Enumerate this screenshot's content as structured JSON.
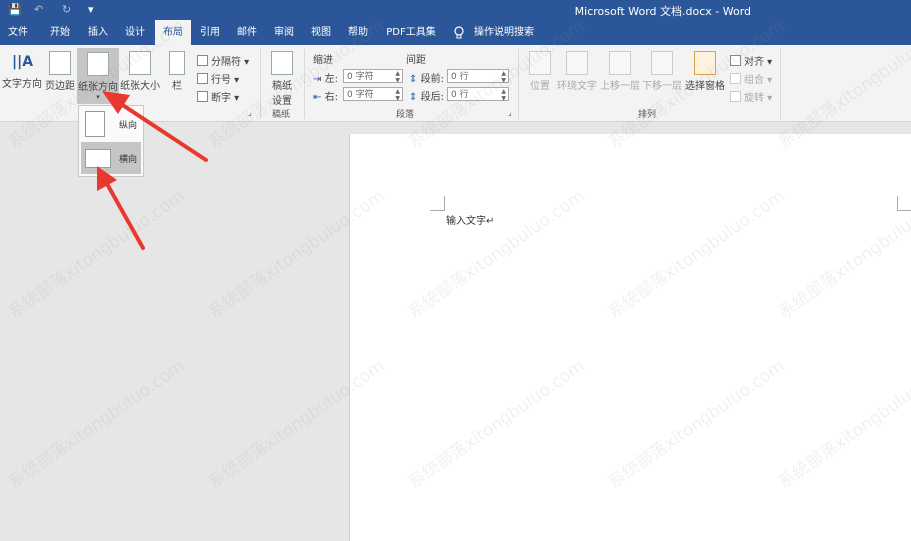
{
  "window": {
    "title": "Microsoft Word 文档.docx  -  Word"
  },
  "quick_access": [
    {
      "name": "save-icon",
      "glyph": "💾"
    },
    {
      "name": "undo-icon",
      "glyph": "↶"
    },
    {
      "name": "redo-icon",
      "glyph": "↻"
    },
    {
      "name": "customize-icon",
      "glyph": "▾"
    }
  ],
  "tabs": [
    "文件",
    "开始",
    "插入",
    "设计",
    "布局",
    "引用",
    "邮件",
    "审阅",
    "视图",
    "帮助",
    "PDF工具集"
  ],
  "tell_me": "操作说明搜索",
  "ribbon": {
    "text_direction": "文字方向",
    "margins": "页边距",
    "orientation": "纸张方向",
    "size": "纸张大小",
    "columns": "栏",
    "breaks": "分隔符",
    "line_numbers": "行号",
    "hyphenation": "断字",
    "manuscript_setup_l1": "稿纸",
    "manuscript_setup_l2": "设置",
    "manuscript_group": "稿纸",
    "indent_header": "缩进",
    "spacing_header": "间距",
    "indent_left": "左:",
    "indent_left_val": "0 字符",
    "indent_right": "右:",
    "indent_right_val": "0 字符",
    "space_before": "段前:",
    "space_before_val": "0 行",
    "space_after": "段后:",
    "space_after_val": "0 行",
    "paragraph_group": "段落",
    "position": "位置",
    "wrap_text": "环绕文字",
    "bring_forward": "上移一层",
    "send_backward": "下移一层",
    "selection_pane": "选择窗格",
    "align": "对齐",
    "group": "组合",
    "rotate": "旋转",
    "arrange_group": "排列"
  },
  "orientation_menu": {
    "portrait": "纵向",
    "landscape": "横向"
  },
  "document": {
    "text": "输入文字↵"
  },
  "watermark": "系统部落xitongbuluo.com",
  "colors": {
    "accent": "#2b579a",
    "arrow": "#e8392f"
  }
}
